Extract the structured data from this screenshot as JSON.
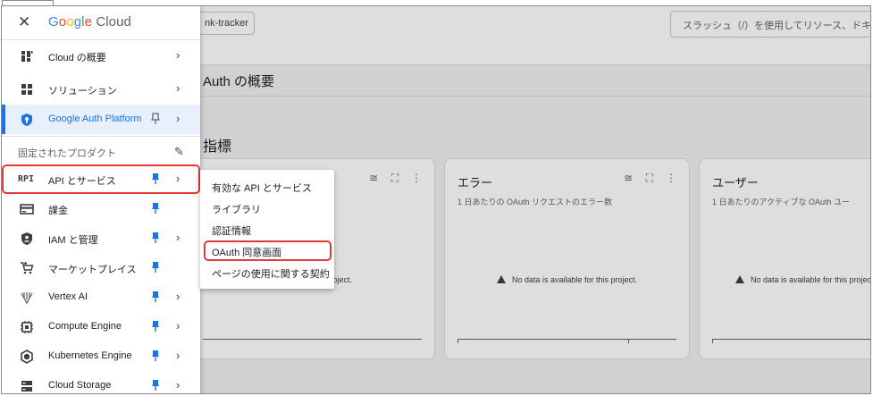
{
  "colors": {
    "accent": "#1a73e8",
    "highlight": "#e53935",
    "pin": "#1a73e8"
  },
  "header": {
    "project_label": "nk-tracker",
    "search_placeholder": "スラッシュ（/）を使用してリソース、ドキ"
  },
  "page": {
    "title": "Auth の概要",
    "section_title": "指標"
  },
  "cards": [
    {
      "title": "",
      "subtitle": "数",
      "no_data": "this project."
    },
    {
      "title": "エラー",
      "subtitle": "1 日あたりの OAuth リクエストのエラー数",
      "no_data": "No data is available for this project."
    },
    {
      "title": "ユーザー",
      "subtitle": "1 日あたりのアクティブな OAuth ユー",
      "no_data": "No data is available for this project."
    }
  ],
  "drawer": {
    "logo_google": [
      "G",
      "o",
      "o",
      "g",
      "l",
      "e"
    ],
    "logo_cloud": "Cloud",
    "top_items": [
      {
        "label": "Cloud の概要",
        "icon": "dashboard-icon"
      },
      {
        "label": "ソリューション",
        "icon": "grid-icon"
      },
      {
        "label": "Google Auth Platform",
        "icon": "auth-shield-icon"
      }
    ],
    "pinned_header": "固定されたプロダクト",
    "pinned_items": [
      {
        "label": "API とサービス",
        "icon": "api-icon",
        "chevron": true
      },
      {
        "label": "課金",
        "icon": "billing-icon",
        "chevron": false
      },
      {
        "label": "IAM と管理",
        "icon": "iam-shield-icon",
        "chevron": true
      },
      {
        "label": "マーケットプレイス",
        "icon": "marketplace-cart-icon",
        "chevron": false
      },
      {
        "label": "Vertex AI",
        "icon": "vertex-ai-icon",
        "chevron": true
      },
      {
        "label": "Compute Engine",
        "icon": "compute-chip-icon",
        "chevron": true
      },
      {
        "label": "Kubernetes Engine",
        "icon": "kubernetes-icon",
        "chevron": true
      },
      {
        "label": "Cloud Storage",
        "icon": "storage-icon",
        "chevron": true
      }
    ]
  },
  "submenu": {
    "items": [
      "有効な API とサービス",
      "ライブラリ",
      "認証情報",
      "OAuth 同意画面",
      "ページの使用に関する契約"
    ]
  }
}
